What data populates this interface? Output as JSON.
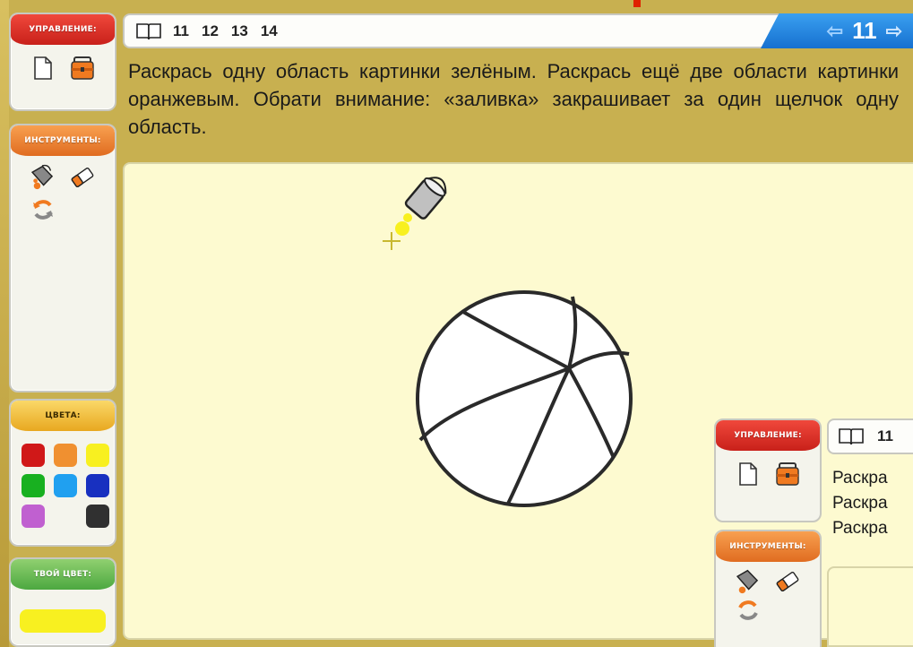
{
  "sidebar": {
    "control_title": "УПРАВЛЕНИЕ:",
    "tools_title": "ИНСТРУМЕНТЫ:",
    "colors_title": "ЦВЕТА:",
    "your_color_title": "ТВОЙ ЦВЕТ:",
    "control_icons": [
      "new-page-icon",
      "briefcase-icon"
    ],
    "tool_icons": [
      "fill-bucket-icon",
      "eraser-icon",
      "reset-icon"
    ],
    "palette": [
      "#d01818",
      "#f09030",
      "#f8f020",
      "#18b020",
      "#20a0f0",
      "#1830c0",
      "#c060d0",
      "",
      "#303030"
    ],
    "current_color": "#f8f020"
  },
  "toolbar": {
    "book_icon": "book-icon",
    "pages": [
      "11",
      "12",
      "13",
      "14"
    ],
    "current_page": "11",
    "prev_icon": "arrow-left-icon",
    "next_icon": "arrow-right-icon"
  },
  "instruction": "Раскрась одну область картинки зелёным. Раскрась ещё две области картинки оранжевым. Обрати внимание: «заливка» закрашивает за один щелчок одну область.",
  "colors": {
    "panel_bg": "#f4f4ec",
    "canvas_bg": "#fdfad0",
    "nav_blue": "#1670d0"
  },
  "overlay": {
    "control_title": "УПРАВЛЕНИЕ:",
    "tools_title": "ИНСТРУМЕНТЫ:",
    "page": "11",
    "text_lines": [
      "Раскра",
      "Раскра",
      "Раскра"
    ]
  }
}
